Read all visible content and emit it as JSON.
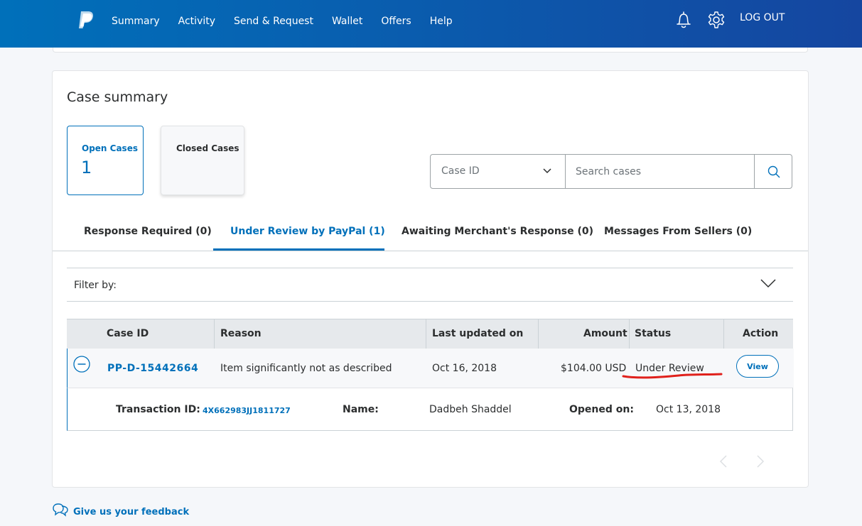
{
  "nav": {
    "items": [
      "Summary",
      "Activity",
      "Send & Request",
      "Wallet",
      "Offers",
      "Help"
    ],
    "logout": "LOG OUT"
  },
  "page": {
    "title": "Case summary"
  },
  "tiles": {
    "open": {
      "label": "Open Cases",
      "count": "1"
    },
    "closed": {
      "label": "Closed Cases"
    }
  },
  "search": {
    "select_value": "Case ID",
    "placeholder": "Search cases"
  },
  "tabs": [
    {
      "label": "Response Required (0)"
    },
    {
      "label": "Under Review by PayPal (1)"
    },
    {
      "label": "Awaiting Merchant's Response (0)"
    },
    {
      "label": "Messages From Sellers (0)"
    }
  ],
  "active_tab": "Under Review by PayPal (1)",
  "filter": {
    "label": "Filter by:"
  },
  "table": {
    "headers": [
      "Case ID",
      "Reason",
      "Last updated on",
      "Amount",
      "Status",
      "Action"
    ],
    "row": {
      "case_id": "PP-D-15442664",
      "reason": "Item significantly not as described",
      "updated": "Oct 16, 2018",
      "amount": "$104.00 USD",
      "status": "Under Review",
      "action": "View"
    },
    "detail": {
      "transaction_label": "Transaction ID:",
      "transaction_id": "4X662983JJ1811727",
      "name_label": "Name:",
      "name": "Dadbeh Shaddel",
      "opened_label": "Opened on:",
      "opened": "Oct 13, 2018"
    }
  },
  "feedback": {
    "label": "Give us your feedback"
  },
  "colors": {
    "brand_blue": "#0070ba",
    "header_gradient_end": "#1546a0",
    "annotation_red": "#e0201b"
  }
}
